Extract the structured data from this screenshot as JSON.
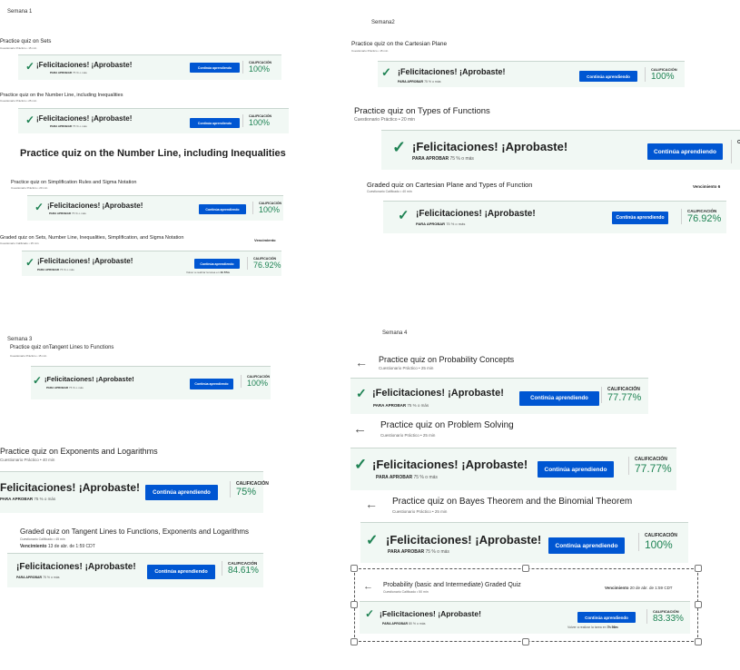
{
  "common": {
    "congrats": "¡Felicitaciones! ¡Aprobaste!",
    "continue": "Continúa aprendiendo",
    "grade_label": "CALIFICACIÓN",
    "pass_label": "PARA APROBAR",
    "pass_75": "75 % o más",
    "pass_80": "80 % o más",
    "due_label": "Vencimiento",
    "due_short": "Vencimiento 6",
    "retake_text": "Volver a realizar la tarea en",
    "check_icon": "✓",
    "back_icon": "←",
    "colors": {
      "accent": "#0056d2",
      "success": "#1f8354",
      "card_bg": "#f1f8f4"
    }
  },
  "week1": {
    "label": "Semana 1",
    "items": [
      {
        "title": "Practice quiz on Sets",
        "sub": "Cuestionario Práctico • 15 min",
        "grade": "100%"
      },
      {
        "title": "Practice quiz on the Number Line, including Inequalities",
        "sub": "Cuestionario Práctico • 25 min",
        "grade": "100%"
      },
      {
        "title": "Practice quiz on Simplification Rules and Sigma Notation",
        "sub": "Cuestionario Práctico • 20 min",
        "grade": "100%"
      },
      {
        "title": "Graded quiz on Sets, Number Line, Inequalities, Simplification, and Sigma Notation",
        "sub": "Cuestionario Calificado • 25 min",
        "grade": "76.92%",
        "due": "Vencimiento",
        "retake": "1h 57m"
      }
    ],
    "big_heading": "Practice quiz on the Number Line, including Inequalities"
  },
  "week2": {
    "label": "Semana2",
    "items": [
      {
        "title": "Practice quiz on the Cartesian Plane",
        "sub": "Cuestionario Práctico • 15 min",
        "grade": "100%"
      },
      {
        "title": "Practice quiz on Types of Functions",
        "sub": "Cuestionario Práctico • 20 min",
        "grade": ""
      },
      {
        "title": "Graded quiz on Cartesian Plane and Types of Function",
        "sub": "Cuestionario Calificado • 40 min",
        "grade": "76.92%"
      }
    ]
  },
  "week3": {
    "label": "Semana 3",
    "items": [
      {
        "title": "Practice quiz onTangent Lines to Functions",
        "sub": "Cuestionario Práctico • 15 min",
        "grade": "100%"
      },
      {
        "title": "Practice quiz on Exponents and Logarithms",
        "sub": "Cuestionario Práctico • 40 min",
        "grade": "75%"
      },
      {
        "title": "Graded quiz on Tangent Lines to Functions, Exponents and Logarithms",
        "sub": "Cuestionario Calificado • 45 min",
        "due": "13 de abr. de 1:59 CDT",
        "grade": "84.61%"
      }
    ]
  },
  "week4": {
    "label": "Semana 4",
    "items": [
      {
        "title": "Practice quiz on Probability Concepts",
        "sub": "Cuestionario Práctico • 25 min",
        "grade": "77.77%"
      },
      {
        "title": "Practice quiz on Problem Solving",
        "sub": "Cuestionario Práctico • 25 min",
        "grade": "77.77%"
      },
      {
        "title": "Practice quiz on Bayes Theorem and the Binomial Theorem",
        "sub": "Cuestionario Práctico • 25 min",
        "grade": "100%"
      },
      {
        "title": "Probability (basic and Intermediate) Graded Quiz",
        "sub": "Cuestionario Calificado • 50 min",
        "due": "20 de abr. de 1:59 CDT",
        "grade": "83.33%",
        "retake": "7h 56m"
      }
    ]
  }
}
